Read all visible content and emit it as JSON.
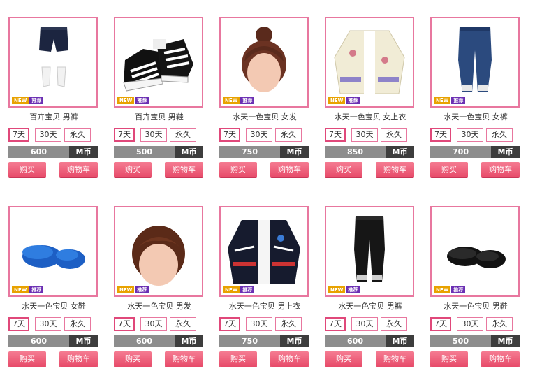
{
  "tags": {
    "new": "NEW",
    "recommended": "推荐"
  },
  "durations": [
    "7天",
    "30天",
    "永久"
  ],
  "currency_label": "M币",
  "buy_label": "购买",
  "cart_label": "购物车",
  "colors": {
    "border": "#e8779f",
    "button": "#ef5d7a",
    "price_bg": "#8d8d8d",
    "currency_bg": "#3d3d3d"
  },
  "products": [
    {
      "name": "百卉宝贝 男裤",
      "price": "600",
      "icon": "shorts-socks-icon"
    },
    {
      "name": "百卉宝贝 男鞋",
      "price": "500",
      "icon": "sneakers-icon"
    },
    {
      "name": "水天一色宝贝 女发",
      "price": "750",
      "icon": "bun-hair-icon"
    },
    {
      "name": "水天一色宝贝 女上衣",
      "price": "850",
      "icon": "cardigan-icon"
    },
    {
      "name": "水天一色宝贝 女裤",
      "price": "700",
      "icon": "jeans-icon"
    },
    {
      "name": "水天一色宝贝 女鞋",
      "price": "600",
      "icon": "blue-slippers-icon"
    },
    {
      "name": "水天一色宝贝 男发",
      "price": "600",
      "icon": "curly-hair-icon"
    },
    {
      "name": "水天一色宝贝 男上衣",
      "price": "750",
      "icon": "jacket-icon"
    },
    {
      "name": "水天一色宝贝 男裤",
      "price": "600",
      "icon": "black-pants-icon"
    },
    {
      "name": "水天一色宝贝 男鞋",
      "price": "500",
      "icon": "black-slippers-icon"
    }
  ]
}
